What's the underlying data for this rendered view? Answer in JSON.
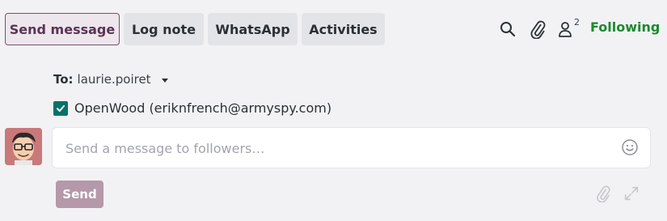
{
  "tabs": [
    {
      "label": "Send message",
      "active": true
    },
    {
      "label": "Log note",
      "active": false
    },
    {
      "label": "WhatsApp",
      "active": false
    },
    {
      "label": "Activities",
      "active": false
    }
  ],
  "toolbar": {
    "followers_count": "2",
    "following_label": "Following"
  },
  "composer": {
    "to_label": "To:",
    "to_value": "laurie.poiret",
    "recipient": "OpenWood (eriknfrench@armyspy.com)",
    "recipient_checked": true,
    "placeholder": "Send a message to followers…",
    "send_label": "Send"
  },
  "colors": {
    "primary": "#7a4f73",
    "following": "#1b8a2f",
    "checkbox": "#01736b",
    "send_disabled": "#b598a9"
  }
}
